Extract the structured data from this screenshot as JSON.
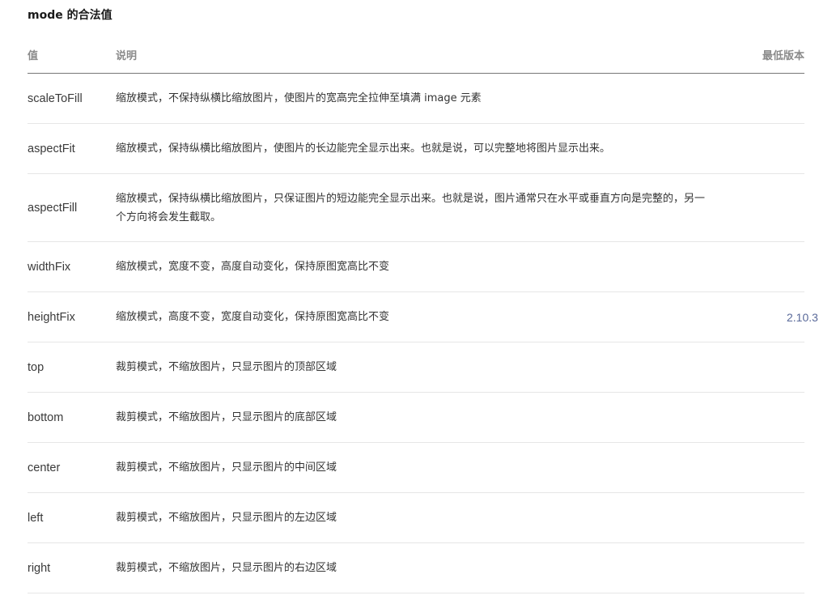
{
  "section": {
    "title": "mode 的合法值"
  },
  "table": {
    "headers": {
      "value": "值",
      "description": "说明",
      "version": "最低版本"
    },
    "rows": [
      {
        "value": "scaleToFill",
        "description": "缩放模式，不保持纵横比缩放图片，使图片的宽高完全拉伸至填满 image 元素",
        "version": ""
      },
      {
        "value": "aspectFit",
        "description": "缩放模式，保持纵横比缩放图片，使图片的长边能完全显示出来。也就是说，可以完整地将图片显示出来。",
        "version": ""
      },
      {
        "value": "aspectFill",
        "description": "缩放模式，保持纵横比缩放图片，只保证图片的短边能完全显示出来。也就是说，图片通常只在水平或垂直方向是完整的，另一个方向将会发生截取。",
        "version": ""
      },
      {
        "value": "widthFix",
        "description": "缩放模式，宽度不变，高度自动变化，保持原图宽高比不变",
        "version": ""
      },
      {
        "value": "heightFix",
        "description": "缩放模式，高度不变，宽度自动变化，保持原图宽高比不变",
        "version": "2.10.3"
      },
      {
        "value": "top",
        "description": "裁剪模式，不缩放图片，只显示图片的顶部区域",
        "version": ""
      },
      {
        "value": "bottom",
        "description": "裁剪模式，不缩放图片，只显示图片的底部区域",
        "version": ""
      },
      {
        "value": "center",
        "description": "裁剪模式，不缩放图片，只显示图片的中间区域",
        "version": ""
      },
      {
        "value": "left",
        "description": "裁剪模式，不缩放图片，只显示图片的左边区域",
        "version": ""
      },
      {
        "value": "right",
        "description": "裁剪模式，不缩放图片，只显示图片的右边区域",
        "version": ""
      }
    ]
  },
  "colors": {
    "text": "#333333",
    "header_text": "#8a8a8a",
    "version_link": "#5a6a9a",
    "row_divider": "#e6e6e6",
    "header_divider": "#777777"
  }
}
